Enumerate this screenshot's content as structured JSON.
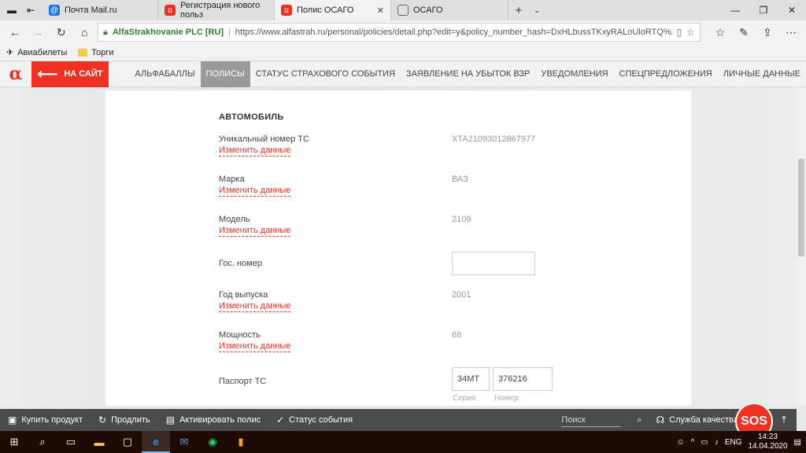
{
  "browser": {
    "tabs": [
      {
        "label": "Почта Mail.ru",
        "icon": "mail-ru-icon"
      },
      {
        "label": "Регистрация нового польз",
        "icon": "alfa-icon"
      },
      {
        "label": "Полис ОСАГО",
        "icon": "alfa-icon"
      },
      {
        "label": "ОСАГО",
        "icon": "page-icon"
      }
    ],
    "cert_name": "AlfaStrakhovanie PLC [RU]",
    "url": "https://www.alfastrah.ru/personal/policies/detail.php?edit=y&policy_number_hash=DxHLbussTKxyRALoUloRTQ%253D%25"
  },
  "favorites": [
    {
      "label": "Авиабилеты"
    },
    {
      "label": "Торги"
    }
  ],
  "site": {
    "back_label": "НА САЙТ",
    "nav": [
      {
        "label": "АЛЬФАБАЛЛЫ",
        "active": false
      },
      {
        "label": "ПОЛИСЫ",
        "active": true
      },
      {
        "label": "СТАТУС СТРАХОВОГО СОБЫТИЯ",
        "active": false
      },
      {
        "label": "ЗАЯВЛЕНИЕ НА УБЫТОК ВЗР",
        "active": false
      },
      {
        "label": "УВЕДОМЛЕНИЯ",
        "active": false
      },
      {
        "label": "СПЕЦПРЕДЛОЖЕНИЯ",
        "active": false
      },
      {
        "label": "ЛИЧНЫЕ ДАННЫЕ",
        "active": false
      }
    ],
    "accent": "#ef3124"
  },
  "form": {
    "section_title": "АВТОМОБИЛЬ",
    "edit_label": "Изменить данные",
    "fields": {
      "vin": {
        "label": "Уникальный номер ТС",
        "value": "XTA21093012867977"
      },
      "brand": {
        "label": "Марка",
        "value": "ВАЗ"
      },
      "model": {
        "label": "Модель",
        "value": "2109"
      },
      "plate": {
        "label": "Гос. номер",
        "value": ""
      },
      "year": {
        "label": "Год выпуска",
        "value": "2001"
      },
      "power": {
        "label": "Мощность",
        "value": "68"
      },
      "passport": {
        "label": "Паспорт ТС",
        "series": "34МТ",
        "number": "376216",
        "series_hint": "Серия",
        "number_hint": "Номер"
      }
    }
  },
  "bottombar": {
    "buy": "Купить продукт",
    "extend": "Продлить",
    "activate": "Активировать полис",
    "status": "Статус события",
    "search_placeholder": "Поиск",
    "support": "Служба качества",
    "sos": "SOS"
  },
  "taskbar": {
    "lang": "ENG",
    "time": "14:23",
    "date": "14.04.2020"
  }
}
